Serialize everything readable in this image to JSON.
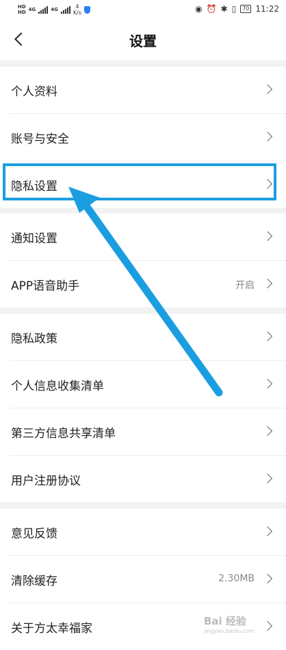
{
  "status": {
    "left": {
      "hd1": "HD",
      "hd2": "HD",
      "net1": "4G",
      "net2": "4G",
      "speed_value": "4",
      "speed_unit": "K/s"
    },
    "battery": "70",
    "time": "11:22"
  },
  "header": {
    "title": "设置"
  },
  "groups": [
    {
      "items": [
        {
          "label": "个人资料"
        },
        {
          "label": "账号与安全"
        },
        {
          "label": "隐私设置"
        }
      ]
    },
    {
      "items": [
        {
          "label": "通知设置"
        },
        {
          "label": "APP语音助手",
          "value": "开启"
        }
      ]
    },
    {
      "items": [
        {
          "label": "隐私政策"
        },
        {
          "label": "个人信息收集清单"
        },
        {
          "label": "第三方信息共享清单"
        },
        {
          "label": "用户注册协议"
        }
      ]
    },
    {
      "items": [
        {
          "label": "意见反馈"
        },
        {
          "label": "清除缓存",
          "value": "2.30MB"
        },
        {
          "label": "关于方太幸福家"
        }
      ]
    }
  ],
  "watermark": {
    "text": "Bai 经验",
    "sub": "jingyan.baidu.com"
  },
  "colors": {
    "highlight": "#1b9ee0",
    "background": "#f2f2f2"
  }
}
